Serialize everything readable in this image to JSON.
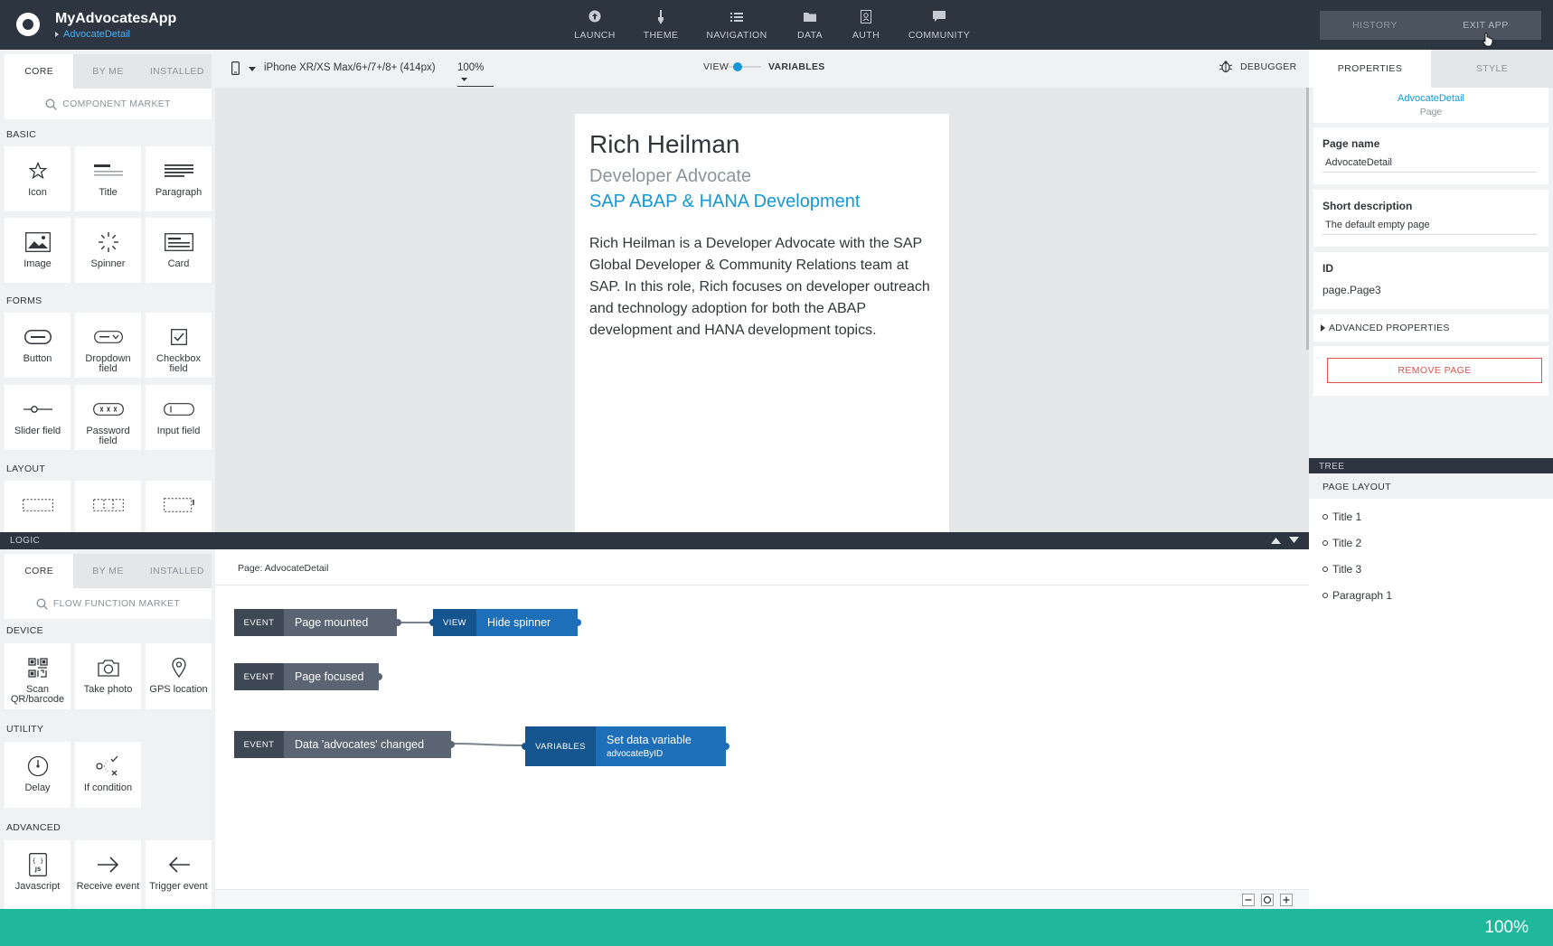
{
  "app": {
    "title": "MyAdvocatesApp",
    "breadcrumb": "AdvocateDetail"
  },
  "topnav": [
    {
      "label": "LAUNCH",
      "icon": "launch-icon"
    },
    {
      "label": "THEME",
      "icon": "theme-brush-icon"
    },
    {
      "label": "NAVIGATION",
      "icon": "navigation-list-icon"
    },
    {
      "label": "DATA",
      "icon": "data-folder-icon"
    },
    {
      "label": "AUTH",
      "icon": "auth-icon"
    },
    {
      "label": "COMMUNITY",
      "icon": "community-chat-icon"
    }
  ],
  "topright": {
    "history": "HISTORY",
    "exit": "EXIT APP"
  },
  "components": {
    "tabs": [
      "CORE",
      "BY ME",
      "INSTALLED"
    ],
    "search_placeholder": "COMPONENT MARKET",
    "sections": {
      "basic": "BASIC",
      "forms": "FORMS",
      "layout": "LAYOUT"
    },
    "basic": [
      "Icon",
      "Title",
      "Paragraph",
      "Image",
      "Spinner",
      "Card"
    ],
    "forms": [
      "Button",
      "Dropdown field",
      "Checkbox field",
      "Slider field",
      "Password field",
      "Input field"
    ]
  },
  "toolbar": {
    "device": "iPhone XR/XS Max/6+/7+/8+ (414px)",
    "zoom": "100%",
    "view": "VIEW",
    "variables": "VARIABLES",
    "debugger": "DEBUGGER"
  },
  "preview": {
    "name": "Rich Heilman",
    "role": "Developer Advocate",
    "topic": "SAP ABAP & HANA Development",
    "bio": "Rich Heilman is a Developer Advocate with the SAP Global Developer & Community Relations team at SAP. In this role, Rich focuses on developer outreach and technology adoption for both the ABAP development and HANA development topics."
  },
  "logic": {
    "bar_label": "LOGIC",
    "tabs": [
      "CORE",
      "BY ME",
      "INSTALLED"
    ],
    "search_placeholder": "FLOW FUNCTION MARKET",
    "sections": {
      "device": "DEVICE",
      "utility": "UTILITY",
      "advanced": "ADVANCED"
    },
    "device": [
      "Scan QR/barcode",
      "Take photo",
      "GPS location"
    ],
    "utility": [
      "Delay",
      "If condition"
    ],
    "advanced": [
      "Javascript",
      "Receive event",
      "Trigger event"
    ],
    "page_label": "Page: AdvocateDetail",
    "nodes": {
      "e1": {
        "kind": "EVENT",
        "label": "Page mounted"
      },
      "v1": {
        "kind": "VIEW",
        "label": "Hide spinner"
      },
      "e2": {
        "kind": "EVENT",
        "label": "Page focused"
      },
      "e3": {
        "kind": "EVENT",
        "label": "Data 'advocates' changed"
      },
      "var1": {
        "kind": "VARIABLES",
        "label": "Set data variable",
        "sub": "advocateByID"
      }
    }
  },
  "properties": {
    "tabs": [
      "PROPERTIES",
      "STYLE"
    ],
    "page_name_link": "AdvocateDetail",
    "page_type": "Page",
    "page_name_label": "Page name",
    "page_name_value": "AdvocateDetail",
    "short_desc_label": "Short description",
    "short_desc_value": "The default empty page",
    "id_label": "ID",
    "id_value": "page.Page3",
    "advanced": "ADVANCED PROPERTIES",
    "remove": "REMOVE PAGE"
  },
  "tree": {
    "bar_label": "TREE",
    "head": "PAGE LAYOUT",
    "items": [
      "Title 1",
      "Title 2",
      "Title 3",
      "Paragraph 1"
    ]
  },
  "status": {
    "zoom": "100%"
  },
  "colors": {
    "topbar": "#2d3541",
    "accent_blue": "#1497d6",
    "danger": "#e0534d",
    "status_bar": "#1fb89c"
  }
}
